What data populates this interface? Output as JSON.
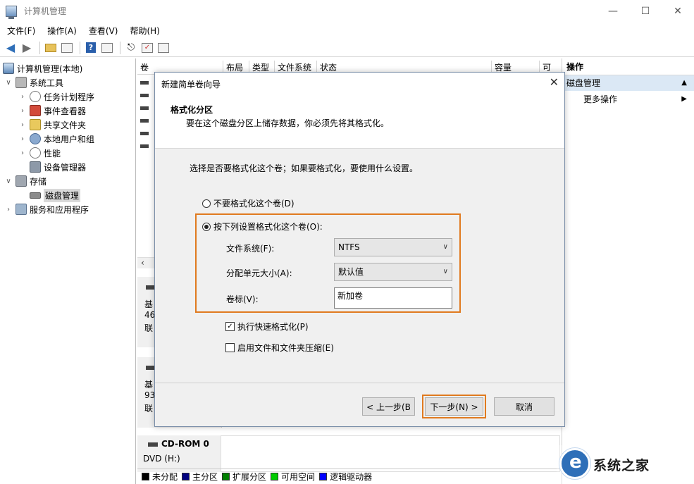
{
  "window": {
    "title": "计算机管理",
    "minimize": "—",
    "maximize": "☐",
    "close": "✕"
  },
  "menu": [
    "文件(F)",
    "操作(A)",
    "查看(V)",
    "帮助(H)"
  ],
  "tree": {
    "root": "计算机管理(本地)",
    "system_tools": "系统工具",
    "task_scheduler": "任务计划程序",
    "event_viewer": "事件查看器",
    "shared_folders": "共享文件夹",
    "local_users": "本地用户和组",
    "performance": "性能",
    "device_manager": "设备管理器",
    "storage": "存储",
    "disk_management": "磁盘管理",
    "services": "服务和应用程序"
  },
  "columns": [
    "卷",
    "布局",
    "类型",
    "文件系统",
    "状态",
    "容量",
    "可"
  ],
  "volume_row_glyphs": [
    "",
    "",
    "",
    "",
    "",
    ""
  ],
  "disks": [
    {
      "line1": "基",
      "line2": "46",
      "line3": "联"
    },
    {
      "line1": "基",
      "line2": "93",
      "line3": "联"
    }
  ],
  "cdrom": {
    "title": "CD-ROM 0",
    "sub": "DVD (H:)"
  },
  "legend": [
    {
      "label": "未分配",
      "color": "#000000"
    },
    {
      "label": "主分区",
      "color": "#000080"
    },
    {
      "label": "扩展分区",
      "color": "#008000"
    },
    {
      "label": "可用空间",
      "color": "#00cc00"
    },
    {
      "label": "逻辑驱动器",
      "color": "#0000ff"
    }
  ],
  "actions": {
    "header": "操作",
    "section": "磁盘管理",
    "more": "更多操作"
  },
  "dialog": {
    "title": "新建简单卷向导",
    "heading": "格式化分区",
    "subheading": "要在这个磁盘分区上储存数据，你必须先将其格式化。",
    "prompt": "选择是否要格式化这个卷；如果要格式化，要使用什么设置。",
    "radio_no_format": "不要格式化这个卷(D)",
    "radio_format": "按下列设置格式化这个卷(O):",
    "fs_label": "文件系统(F):",
    "fs_value": "NTFS",
    "alloc_label": "分配单元大小(A):",
    "alloc_value": "默认值",
    "vol_label": "卷标(V):",
    "vol_value": "新加卷",
    "quick_format": "执行快速格式化(P)",
    "compression": "启用文件和文件夹压缩(E)",
    "back": "< 上一步(B",
    "next": "下一步(N) >",
    "cancel": "取消"
  },
  "watermark": {
    "text": "系统之家"
  }
}
